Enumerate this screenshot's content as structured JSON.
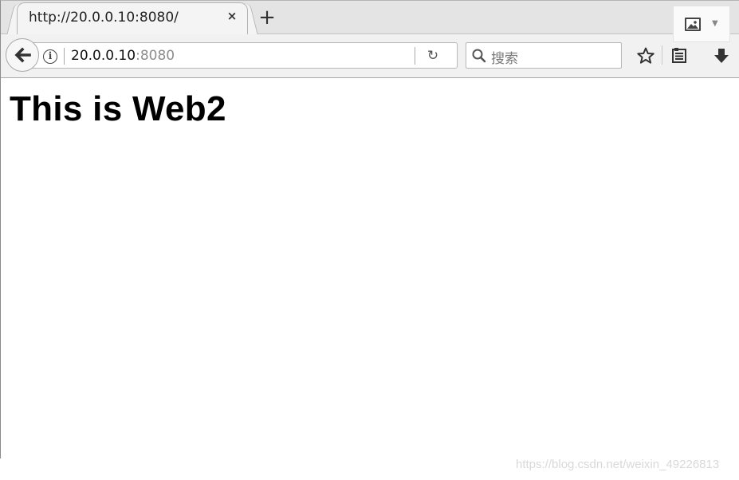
{
  "tab": {
    "title": "http://20.0.0.10:8080/",
    "close_glyph": "×"
  },
  "newtab": {
    "glyph": "+"
  },
  "urlbar": {
    "host": "20.0.0.10",
    "port": ":8080",
    "info_glyph": "i",
    "reload_glyph": "↻"
  },
  "search": {
    "placeholder": "搜索"
  },
  "page": {
    "heading": "This is Web2"
  },
  "watermark": {
    "text": "https://blog.csdn.net/weixin_49226813"
  },
  "icons": {
    "back": "arrow-left-icon",
    "info": "info-icon",
    "reload": "reload-icon",
    "search": "magnifier-icon",
    "bookmark": "star-icon",
    "library": "library-icon",
    "download": "download-icon",
    "media": "image-icon"
  }
}
